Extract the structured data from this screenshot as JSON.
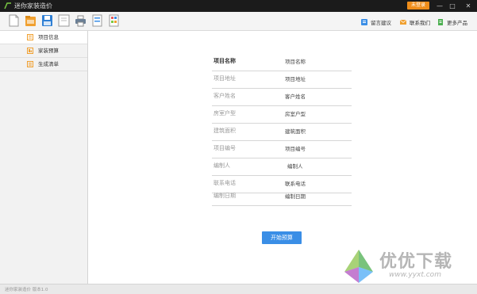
{
  "window": {
    "title": "迷你家装造价",
    "login_label": "未登录",
    "minimize_glyph": "—",
    "maximize_glyph": "□",
    "close_glyph": "✕"
  },
  "toolbar": {
    "tools": [
      "new-icon",
      "open-folder-icon",
      "save-icon",
      "preview-icon",
      "print-icon",
      "export-icon",
      "calculator-icon"
    ],
    "links": [
      {
        "label": "留言建议",
        "icon": "feedback-icon"
      },
      {
        "label": "联系我们",
        "icon": "mail-icon"
      },
      {
        "label": "更多产品",
        "icon": "products-icon"
      }
    ]
  },
  "sidebar": {
    "items": [
      {
        "label": "项目信息",
        "icon": "info-icon",
        "active": true
      },
      {
        "label": "家装预算",
        "icon": "budget-icon",
        "active": false
      },
      {
        "label": "生成清单",
        "icon": "list-icon",
        "active": false
      }
    ]
  },
  "form": {
    "rows": [
      {
        "label": "项目名称",
        "value": "项目名称"
      },
      {
        "label": "项目地址",
        "value": "项目地址"
      },
      {
        "label": "客户姓名",
        "value": "客户姓名"
      },
      {
        "label": "房室户型",
        "value": "房室户型"
      },
      {
        "label": "建筑面积",
        "value": "建筑面积"
      },
      {
        "label": "项目编号",
        "value": "项目编号"
      },
      {
        "label": "编制人",
        "value": "编制人"
      },
      {
        "label": "联系电话",
        "value": "联系电话"
      },
      {
        "label": "编制日期",
        "value": "编制日期"
      }
    ],
    "start_button": "开始预算"
  },
  "status": {
    "text": "迷你家装造价  版本1.0"
  },
  "watermark": {
    "text": "优优下载",
    "url": "www.yyxt.com"
  },
  "colors": {
    "titlebar": "#1b1b1b",
    "login": "#ef8d1a",
    "accent": "#3a8ee6",
    "icon_orange": "#f0a030"
  }
}
